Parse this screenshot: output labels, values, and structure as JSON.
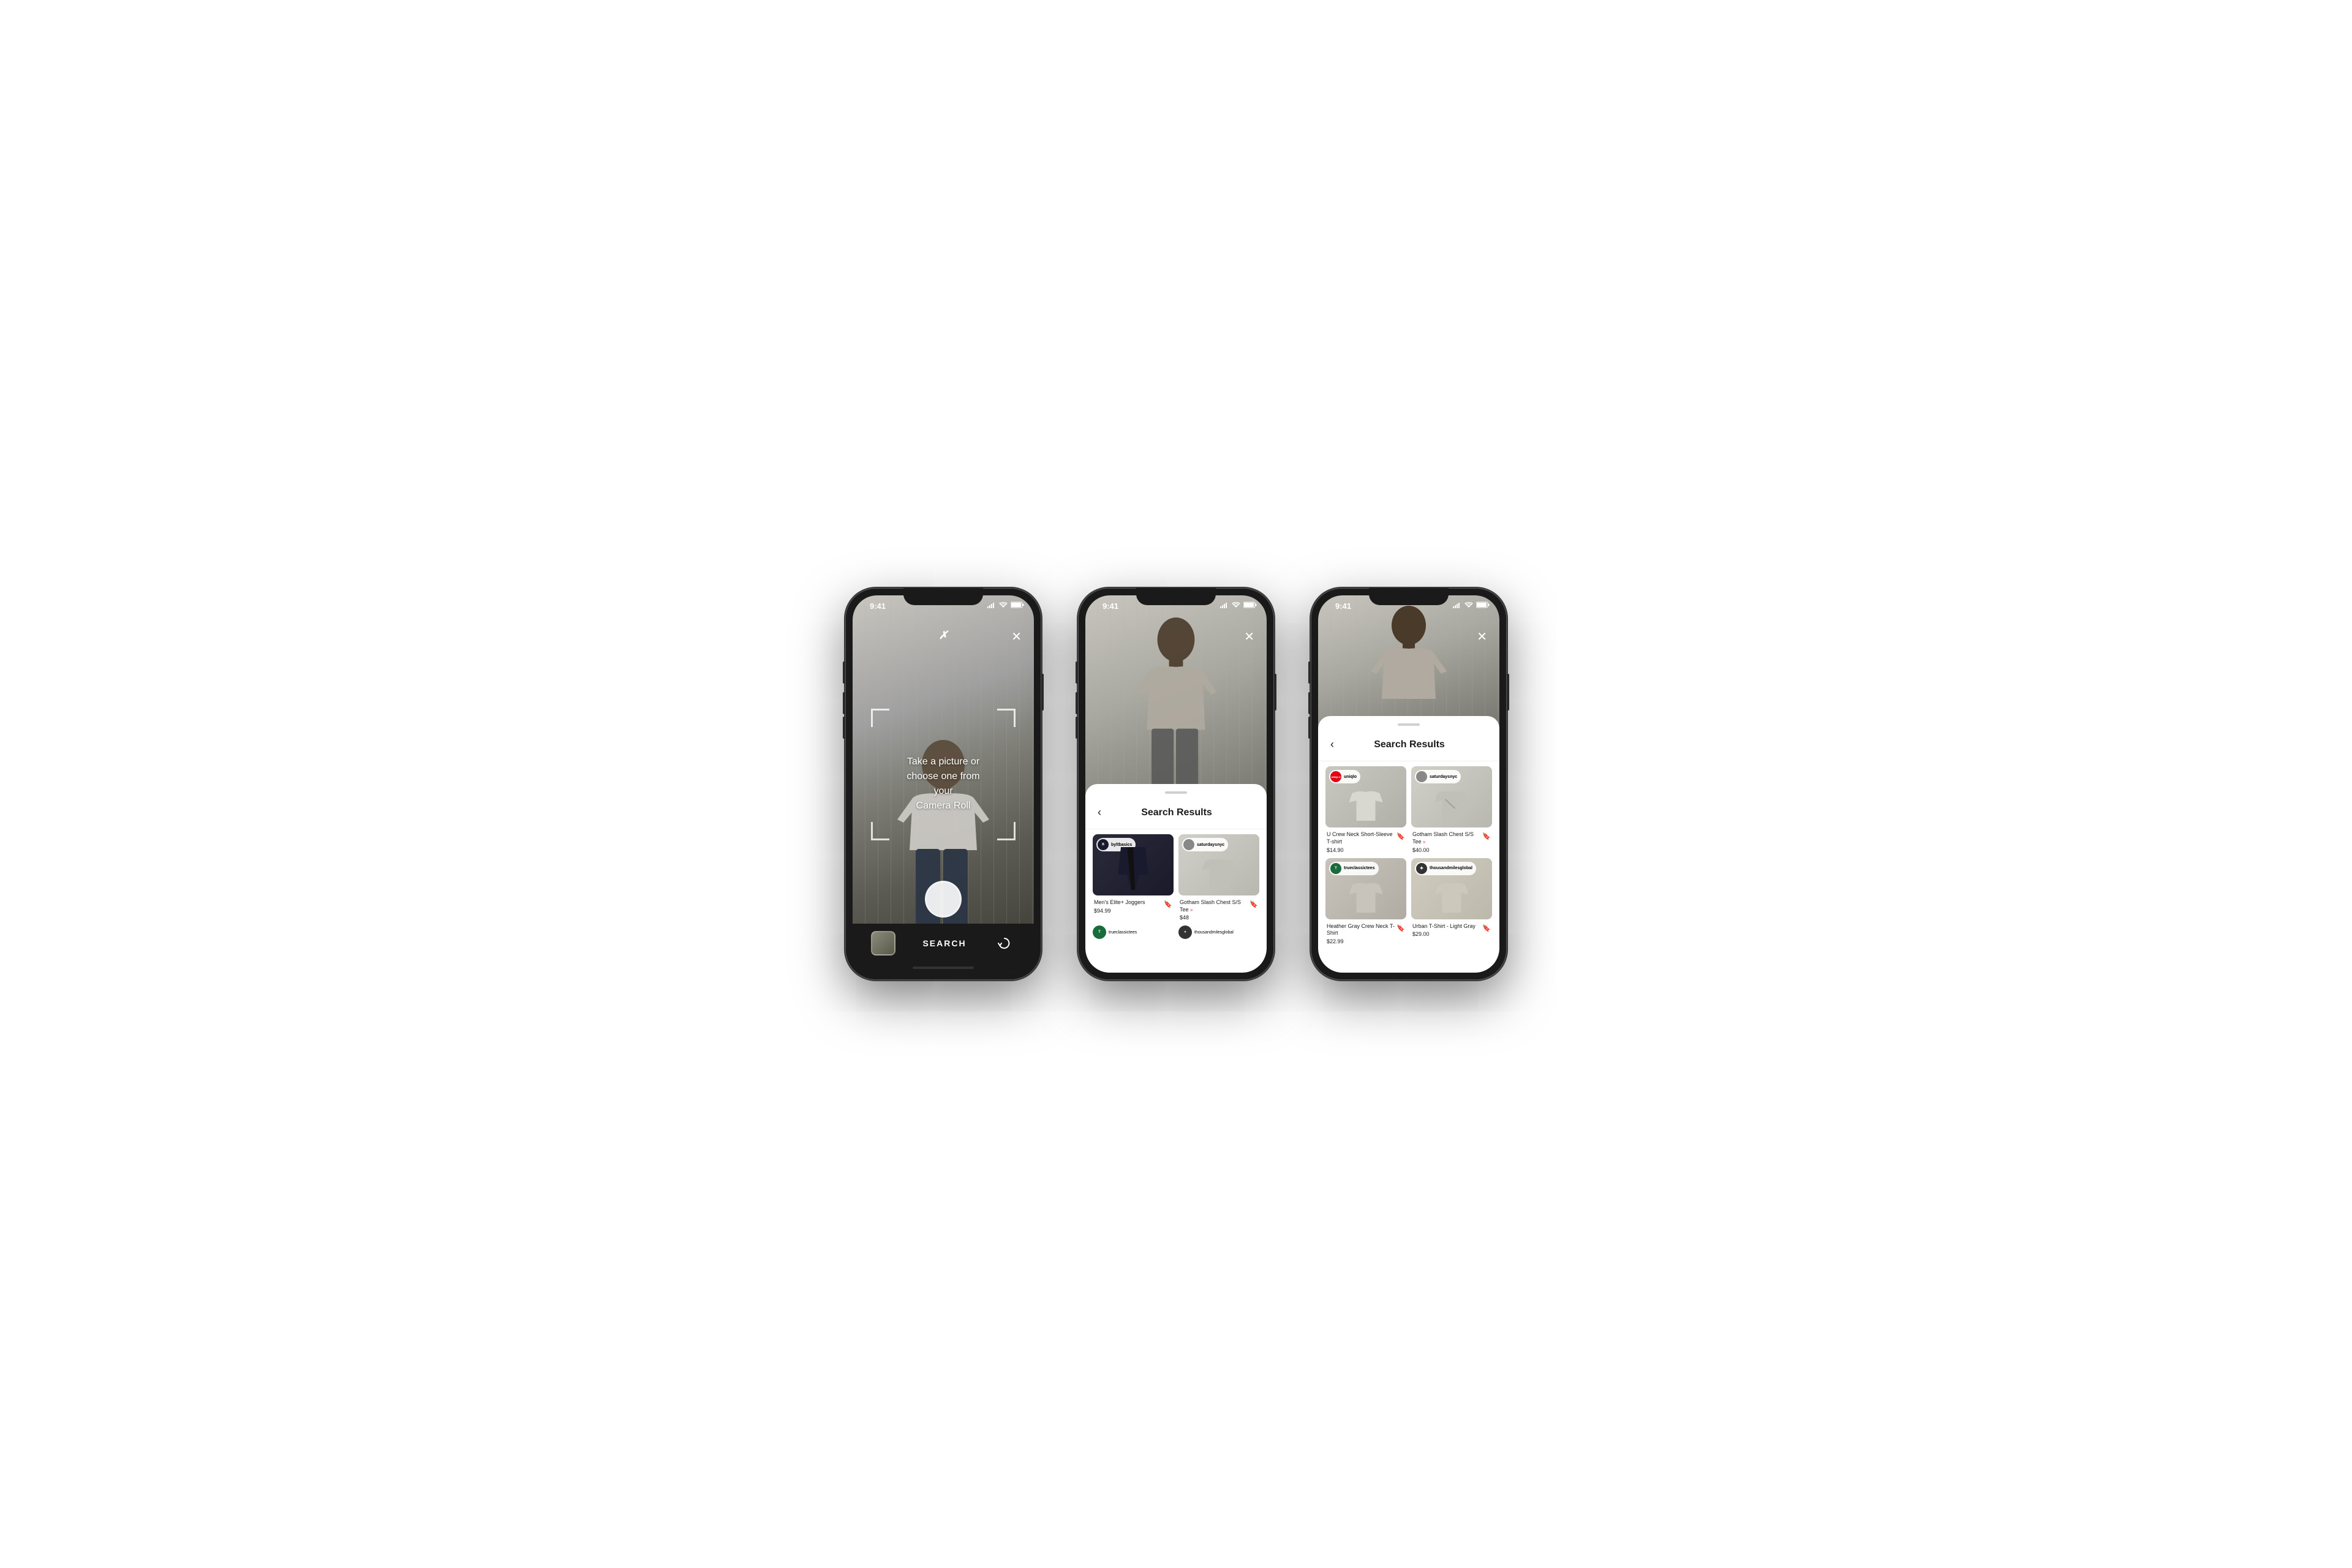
{
  "page": {
    "background": "#ffffff"
  },
  "phones": [
    {
      "id": "phone1",
      "status_time": "9:41",
      "screen_type": "camera",
      "logo": "✗",
      "overlay_text": "Take a picture or\nchoose one from your\nCamera Roll",
      "close_label": "✕",
      "bottom": {
        "search_label": "SEARCH"
      }
    },
    {
      "id": "phone2",
      "status_time": "9:41",
      "screen_type": "results_partial",
      "close_label": "✕",
      "sheet": {
        "title": "Search Results",
        "back_label": "‹",
        "products": [
          {
            "brand": "byltbasics",
            "brand_type": "bylt",
            "name": "Men's Elite+ Joggers",
            "price": "$94.99",
            "image_type": "joggers"
          },
          {
            "brand": "saturdaysnyc",
            "brand_type": "saturdays",
            "name": "Gotham Slash Chest S/S Tee",
            "price": "$48",
            "has_arrow": true,
            "image_type": "gray-tshirt"
          }
        ],
        "partial_brands": [
          "trueclassictees",
          "thousandmilesglobal"
        ]
      }
    },
    {
      "id": "phone3",
      "status_time": "9:41",
      "screen_type": "results_full",
      "close_label": "✕",
      "sheet": {
        "title": "Search Results",
        "back_label": "‹",
        "products": [
          {
            "brand": "uniqlo",
            "brand_type": "uniqlo",
            "brand_label": "UNIQLO",
            "name": "U Crew Neck Short-Sleeve T-shirt",
            "price": "$14.90",
            "image_type": "light-gray-tshirt"
          },
          {
            "brand": "saturdaysnyc",
            "brand_type": "saturdays",
            "name": "Gotham Slash Chest S/S Tee",
            "price": "$40.00",
            "has_arrow": true,
            "image_type": "gray-tshirt"
          },
          {
            "brand": "trueclassictees",
            "brand_type": "trueclassic",
            "name": "Heather Gray Crew Neck T-Shirt",
            "price": "$22.99",
            "image_type": "heather-gray-tshirt"
          },
          {
            "brand": "thousandmilesglobal",
            "brand_type": "thousandmiles",
            "name": "Urban T-Shirt - Light Gray",
            "price": "$29.00",
            "image_type": "tan-tshirt"
          }
        ]
      }
    }
  ]
}
